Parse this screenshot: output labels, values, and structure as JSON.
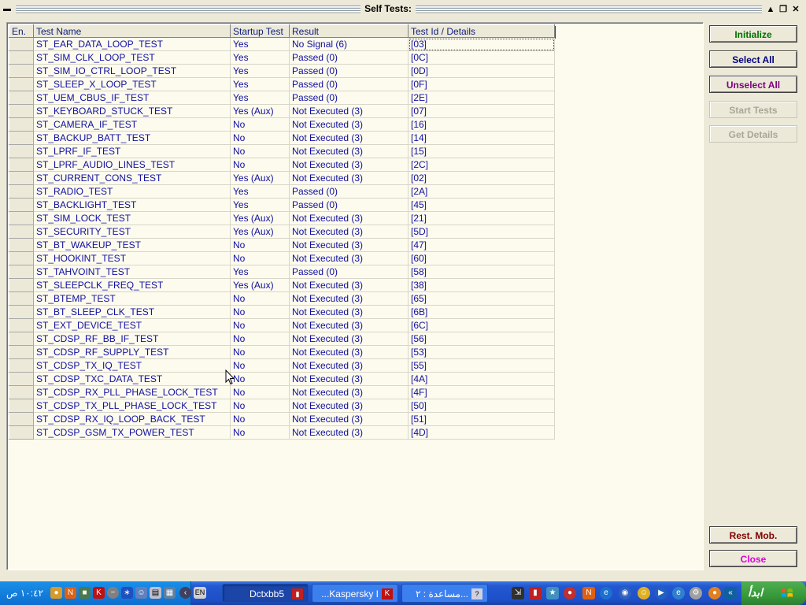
{
  "window": {
    "title": "Self Tests:",
    "sysmenu_icon": "minus-icon",
    "controls": [
      "minimize-icon",
      "restore-icon",
      "close-icon"
    ]
  },
  "grid": {
    "columns": [
      "En.",
      "Test Name",
      "Startup Test",
      "Result",
      "Test Id / Details"
    ],
    "rows": [
      [
        "ST_EAR_DATA_LOOP_TEST",
        "Yes",
        "No Signal (6)",
        "[03]"
      ],
      [
        "ST_SIM_CLK_LOOP_TEST",
        "Yes",
        "Passed (0)",
        "[0C]"
      ],
      [
        "ST_SIM_IO_CTRL_LOOP_TEST",
        "Yes",
        "Passed (0)",
        "[0D]"
      ],
      [
        "ST_SLEEP_X_LOOP_TEST",
        "Yes",
        "Passed (0)",
        "[0F]"
      ],
      [
        "ST_UEM_CBUS_IF_TEST",
        "Yes",
        "Passed (0)",
        "[2E]"
      ],
      [
        "ST_KEYBOARD_STUCK_TEST",
        "Yes (Aux)",
        "Not Executed (3)",
        "[07]"
      ],
      [
        "ST_CAMERA_IF_TEST",
        "No",
        "Not Executed (3)",
        "[16]"
      ],
      [
        "ST_BACKUP_BATT_TEST",
        "No",
        "Not Executed (3)",
        "[14]"
      ],
      [
        "ST_LPRF_IF_TEST",
        "No",
        "Not Executed (3)",
        "[15]"
      ],
      [
        "ST_LPRF_AUDIO_LINES_TEST",
        "No",
        "Not Executed (3)",
        "[2C]"
      ],
      [
        "ST_CURRENT_CONS_TEST",
        "Yes (Aux)",
        "Not Executed (3)",
        "[02]"
      ],
      [
        "ST_RADIO_TEST",
        "Yes",
        "Passed (0)",
        "[2A]"
      ],
      [
        "ST_BACKLIGHT_TEST",
        "Yes",
        "Passed (0)",
        "[45]"
      ],
      [
        "ST_SIM_LOCK_TEST",
        "Yes (Aux)",
        "Not Executed (3)",
        "[21]"
      ],
      [
        "ST_SECURITY_TEST",
        "Yes (Aux)",
        "Not Executed (3)",
        "[5D]"
      ],
      [
        "ST_BT_WAKEUP_TEST",
        "No",
        "Not Executed (3)",
        "[47]"
      ],
      [
        "ST_HOOKINT_TEST",
        "No",
        "Not Executed (3)",
        "[60]"
      ],
      [
        "ST_TAHVOINT_TEST",
        "Yes",
        "Passed (0)",
        "[58]"
      ],
      [
        "ST_SLEEPCLK_FREQ_TEST",
        "Yes (Aux)",
        "Not Executed (3)",
        "[38]"
      ],
      [
        "ST_BTEMP_TEST",
        "No",
        "Not Executed (3)",
        "[65]"
      ],
      [
        "ST_BT_SLEEP_CLK_TEST",
        "No",
        "Not Executed (3)",
        "[6B]"
      ],
      [
        "ST_EXT_DEVICE_TEST",
        "No",
        "Not Executed (3)",
        "[6C]"
      ],
      [
        "ST_CDSP_RF_BB_IF_TEST",
        "No",
        "Not Executed (3)",
        "[56]"
      ],
      [
        "ST_CDSP_RF_SUPPLY_TEST",
        "No",
        "Not Executed (3)",
        "[53]"
      ],
      [
        "ST_CDSP_TX_IQ_TEST",
        "No",
        "Not Executed (3)",
        "[55]"
      ],
      [
        "ST_CDSP_TXC_DATA_TEST",
        "No",
        "Not Executed (3)",
        "[4A]"
      ],
      [
        "ST_CDSP_RX_PLL_PHASE_LOCK_TEST",
        "No",
        "Not Executed (3)",
        "[4F]"
      ],
      [
        "ST_CDSP_TX_PLL_PHASE_LOCK_TEST",
        "No",
        "Not Executed (3)",
        "[50]"
      ],
      [
        "ST_CDSP_RX_IQ_LOOP_BACK_TEST",
        "No",
        "Not Executed (3)",
        "[51]"
      ],
      [
        "ST_CDSP_GSM_TX_POWER_TEST",
        "No",
        "Not Executed (3)",
        "[4D]"
      ]
    ]
  },
  "buttons": {
    "initialize": {
      "label": "Initialize",
      "color": "#007000"
    },
    "select_all": {
      "label": "Select All",
      "color": "#000080"
    },
    "unselect_all": {
      "label": "Unselect All",
      "color": "#800080"
    },
    "start_tests": {
      "label": "Start Tests"
    },
    "get_details": {
      "label": "Get Details"
    },
    "rest_mob": {
      "label": "Rest. Mob.",
      "color": "#800000"
    },
    "close": {
      "label": "Close",
      "color": "#e000e0"
    }
  },
  "taskbar": {
    "clock": "١٠:٤٢ ص",
    "lang": "EN",
    "tasks": [
      {
        "label": "Dctxbb5",
        "active": true
      },
      {
        "label": "...Kaspersky I",
        "active": false
      },
      {
        "label": "مساعدة : ٢...",
        "active": false
      }
    ],
    "start_label": "ابدأ"
  }
}
